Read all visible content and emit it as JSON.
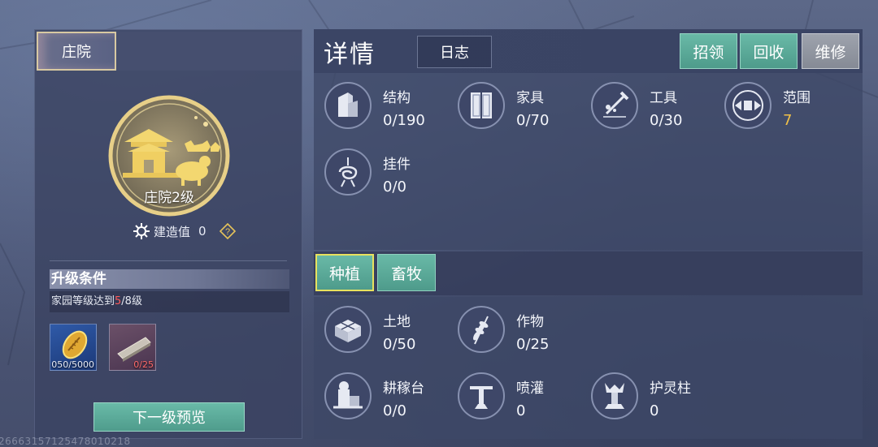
{
  "left": {
    "tab_label": "庄院",
    "emblem_label": "庄院2级",
    "build_label": "建造值",
    "build_value": "0",
    "upgrade_title": "升级条件",
    "condition_prefix": "家园等级达到",
    "condition_current": "5",
    "condition_suffix": "/8级",
    "items": [
      {
        "icon": "gold-seed-icon",
        "count": "050/5000"
      },
      {
        "icon": "wood-plank-icon",
        "count": "0/25"
      }
    ],
    "preview_button": "下一级预览",
    "footer_id": "266631571254780102​18"
  },
  "right": {
    "title": "详情",
    "log_tab": "日志",
    "buttons": {
      "recruit": "招领",
      "recycle": "回收",
      "repair": "维修"
    },
    "upper_stats": [
      {
        "name": "结构",
        "value": "0/190",
        "icon": "structure-icon"
      },
      {
        "name": "家具",
        "value": "0/70",
        "icon": "furniture-icon"
      },
      {
        "name": "工具",
        "value": "0/30",
        "icon": "tools-icon"
      },
      {
        "name": "范围",
        "value": "7",
        "icon": "range-icon"
      },
      {
        "name": "挂件",
        "value": "0/0",
        "icon": "pendant-icon"
      }
    ],
    "tabs": {
      "plant": "种植",
      "herd": "畜牧"
    },
    "lower_stats": [
      {
        "name": "土地",
        "value": "0/50",
        "icon": "land-icon"
      },
      {
        "name": "作物",
        "value": "0/25",
        "icon": "crop-icon"
      },
      {
        "name": "耕稼台",
        "value": "0/0",
        "icon": "farm-platform-icon"
      },
      {
        "name": "喷灌",
        "value": "0",
        "icon": "sprinkler-icon"
      },
      {
        "name": "护灵柱",
        "value": "0",
        "icon": "spirit-pillar-icon"
      }
    ]
  },
  "colors": {
    "accent_green": "#5aa898",
    "gold": "#f0c048",
    "warning_red": "#ff5a5a",
    "tab_highlight": "#e8e25e"
  }
}
